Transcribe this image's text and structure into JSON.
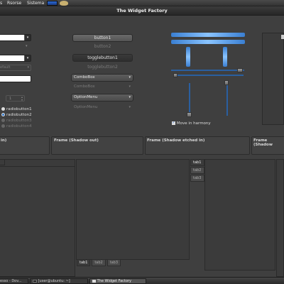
{
  "panel": {
    "menu_actions": "s",
    "menu_places": "Rsorse",
    "menu_system": "Sistema"
  },
  "window": {
    "title": "The Widget Factory"
  },
  "left": {
    "entry_disabled": "efault",
    "spin_value": "1",
    "radios": [
      {
        "label": "radiobutton1",
        "selected": false,
        "disabled": false
      },
      {
        "label": "radiobutton2",
        "selected": true,
        "disabled": false
      },
      {
        "label": "radiobutton3",
        "selected": false,
        "disabled": true
      },
      {
        "label": "radiobutton4",
        "selected": false,
        "disabled": true
      }
    ],
    "dropdown_arrow": "▾"
  },
  "middle": {
    "button1": "button1",
    "button2": "button2",
    "toggle1": "togglebutton1",
    "toggle2": "togglebutton2",
    "combo1": "ComboBox",
    "combo2": "ComboBox",
    "option1": "OptionMenu",
    "option2": "OptionMenu",
    "arrow": "▾"
  },
  "right": {
    "move_in_harmony": "Move in harmony",
    "checked": true
  },
  "frames": {
    "f0": "in)",
    "f1": "Frame (Shadow out)",
    "f2": "Frame (Shadow etched in)",
    "f3": "Frame (Shadow"
  },
  "notebook_bottom": {
    "tabs": [
      "tab1",
      "tab2",
      "tab3"
    ]
  },
  "notebook_side": {
    "tabs": [
      "tab1",
      "tab2",
      "tab3"
    ]
  },
  "taskbar": {
    "items": [
      "esso - Dov...",
      "[user@ubuntu: ~]",
      "The Widget Factory"
    ]
  }
}
